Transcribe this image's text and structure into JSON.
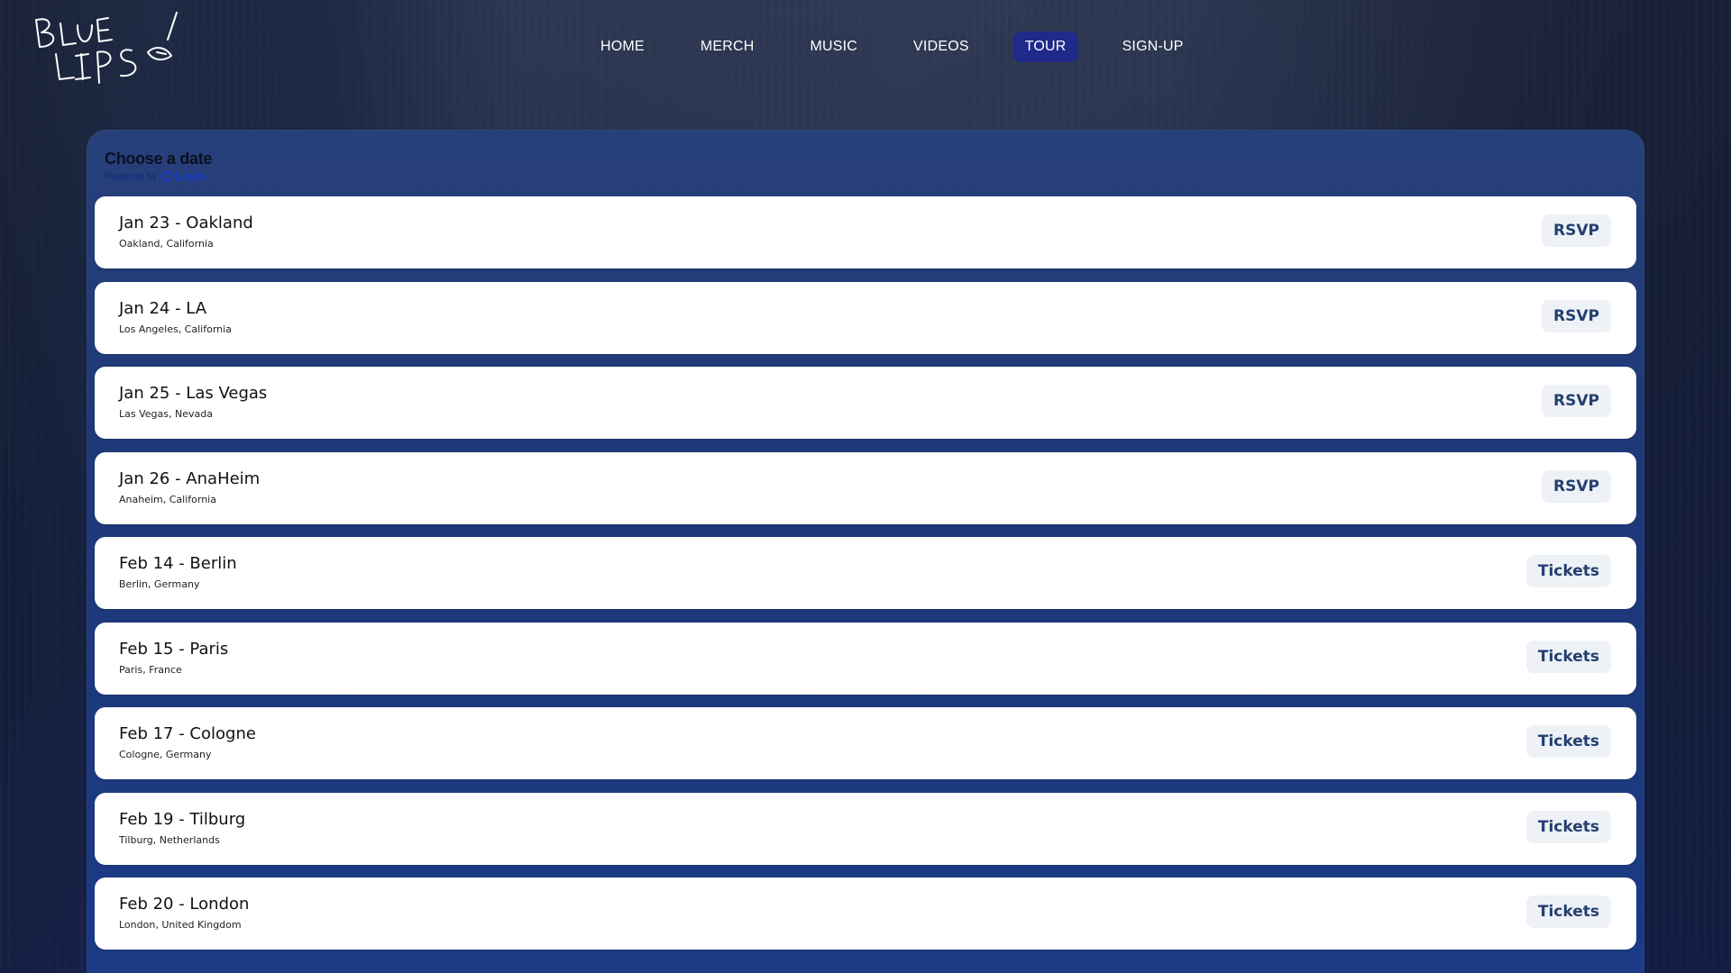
{
  "brand": {
    "logo_text": "BLUE LIPS"
  },
  "nav": {
    "items": [
      {
        "label": "HOME",
        "active": false
      },
      {
        "label": "MERCH",
        "active": false
      },
      {
        "label": "MUSIC",
        "active": false
      },
      {
        "label": "VIDEOS",
        "active": false
      },
      {
        "label": "TOUR",
        "active": true
      },
      {
        "label": "SIGN-UP",
        "active": false
      }
    ]
  },
  "tour": {
    "title": "Choose a date",
    "powered_by": "Powered by",
    "powered_brand": "Laylo",
    "events": [
      {
        "title": "Jan 23 - Oakland",
        "location": "Oakland, California",
        "action": "RSVP"
      },
      {
        "title": "Jan 24 - LA",
        "location": "Los Angeles, California",
        "action": "RSVP"
      },
      {
        "title": "Jan 25 - Las Vegas",
        "location": "Las Vegas, Nevada",
        "action": "RSVP"
      },
      {
        "title": "Jan 26 - AnaHeim",
        "location": "Anaheim, California",
        "action": "RSVP"
      },
      {
        "title": "Feb 14 - Berlin",
        "location": "Berlin, Germany",
        "action": "Tickets"
      },
      {
        "title": "Feb 15 - Paris",
        "location": "Paris, France",
        "action": "Tickets"
      },
      {
        "title": "Feb 17 - Cologne",
        "location": "Cologne, Germany",
        "action": "Tickets"
      },
      {
        "title": "Feb 19 - Tilburg",
        "location": "Tilburg, Netherlands",
        "action": "Tickets"
      },
      {
        "title": "Feb 20 - London",
        "location": "London, United Kingdom",
        "action": "Tickets"
      }
    ]
  },
  "colors": {
    "nav_active_bg": "#1f2a8a",
    "panel_bg": "#1e3878",
    "button_bg": "#eef1f6",
    "button_text": "#23406f"
  }
}
